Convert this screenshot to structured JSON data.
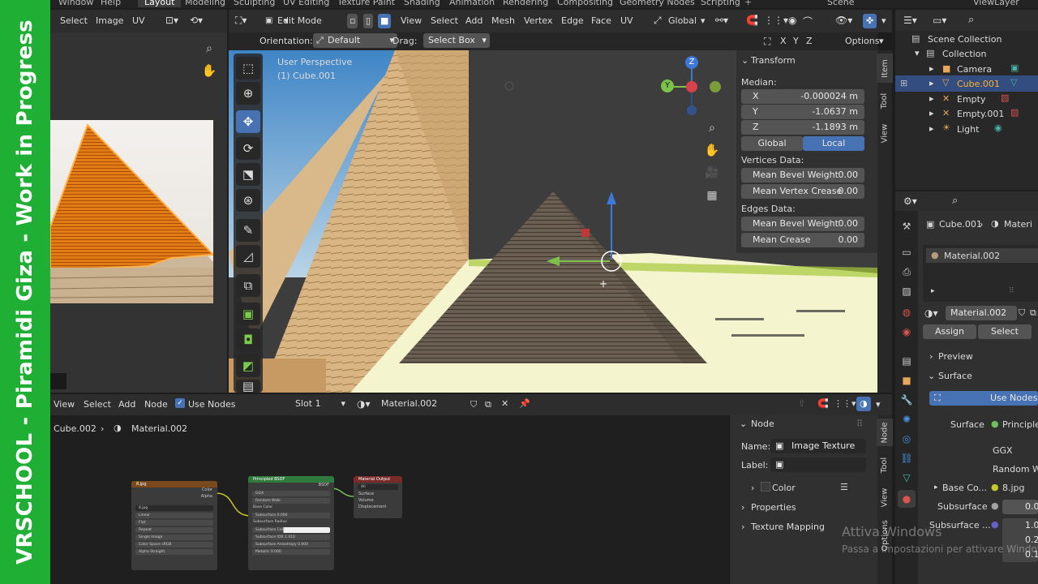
{
  "banner": {
    "text": "VRSCHOOL - Piramidi Giza - Work in Progress"
  },
  "menu": {
    "window": "Window",
    "help": "Help"
  },
  "workspaces": [
    "Layout",
    "Modeling",
    "Sculpting",
    "UV Editing",
    "Texture Paint",
    "Shading",
    "Animation",
    "Rendering",
    "Compositing",
    "Geometry Nodes",
    "Scripting"
  ],
  "scene": "Scene",
  "view_layer": "ViewLayer",
  "image_editor": {
    "select": "Select",
    "image": "Image",
    "uv": "UV"
  },
  "viewport_header": {
    "mode": "Edit Mode",
    "view": "View",
    "select": "Select",
    "add": "Add",
    "mesh": "Mesh",
    "vertex": "Vertex",
    "edge": "Edge",
    "face": "Face",
    "uv": "UV",
    "transform_orientation": "Global",
    "orientation_label": "Orientation:",
    "orientation_value": "Default",
    "drag_label": "Drag:",
    "drag_value": "Select Box",
    "axes": [
      "X",
      "Y",
      "Z"
    ],
    "options": "Options"
  },
  "viewport": {
    "perspective": "User Perspective",
    "object": "(1) Cube.001"
  },
  "gizmo": {
    "x": "X",
    "y": "Y",
    "z": "Z"
  },
  "npanel": {
    "title": "Transform",
    "median": "Median:",
    "fields": [
      {
        "label": "X",
        "value": "-0.000024 m"
      },
      {
        "label": "Y",
        "value": "-1.0637 m"
      },
      {
        "label": "Z",
        "value": "-1.1893 m"
      }
    ],
    "global": "Global",
    "local": "Local",
    "vertices_data": "Vertices Data:",
    "vertex_fields": [
      {
        "label": "Mean Bevel Weight",
        "value": "0.00"
      },
      {
        "label": "Mean Vertex Crease",
        "value": "0.00"
      }
    ],
    "edges_data": "Edges Data:",
    "edge_fields": [
      {
        "label": "Mean Bevel Weight",
        "value": "0.00"
      },
      {
        "label": "Mean Crease",
        "value": "0.00"
      }
    ],
    "tabs": [
      "Item",
      "Tool",
      "View"
    ]
  },
  "outliner": {
    "items": [
      {
        "label": "Scene Collection",
        "icon": "collection-icon"
      },
      {
        "label": "Collection",
        "icon": "collection-icon"
      },
      {
        "label": "Camera",
        "icon": "camera-icon"
      },
      {
        "label": "Cube.001",
        "icon": "mesh-icon",
        "selected": true
      },
      {
        "label": "Empty",
        "icon": "empty-icon"
      },
      {
        "label": "Empty.001",
        "icon": "empty-icon"
      },
      {
        "label": "Light",
        "icon": "light-icon"
      }
    ]
  },
  "properties": {
    "breadcrumb_object": "Cube.001",
    "breadcrumb_material": "Materi",
    "slot": "Material.002",
    "material": "Material.002",
    "assign": "Assign",
    "select": "Select",
    "preview": "Preview",
    "surface_section": "Surface",
    "use_nodes": "Use Nodes",
    "surface_label": "Surface",
    "surface_value": "Principled",
    "distribution": "GGX",
    "subsurface_method": "Random Wa",
    "base_color_label": "Base Co...",
    "base_color_value": "8.jpg",
    "subsurface_label": "Subsurface",
    "subsurface_value": "0.00",
    "subsurface2_label": "Subsurface ...",
    "subsurface2_values": [
      "1.0",
      "0.2",
      "0.1"
    ]
  },
  "node_editor": {
    "view": "View",
    "select": "Select",
    "add": "Add",
    "node": "Node",
    "use_nodes": "Use Nodes",
    "slot": "Slot 1",
    "material": "Material.002",
    "breadcrumb_object": "Cube.002",
    "breadcrumb_material": "Material.002"
  },
  "node_sidebar": {
    "title": "Node",
    "name_label": "Name:",
    "name_value": "Image Texture",
    "label_label": "Label:",
    "color": "Color",
    "properties": "Properties",
    "texture_mapping": "Texture Mapping",
    "tabs": [
      "Node",
      "Tool",
      "View",
      "Options"
    ]
  },
  "nodes": {
    "image": {
      "title": "8.jpg",
      "outputs": [
        "Color",
        "Alpha"
      ],
      "file": "8.jpg",
      "rows": [
        "Linear",
        "Flat",
        "Repeat",
        "Single Image",
        "Color Space   sRGB",
        "Alpha   Straight"
      ]
    },
    "bsdf": {
      "title": "Principled BSDF",
      "output": "BSDF",
      "rows": [
        "GGX",
        "Random Walk",
        "Base Color",
        "Subsurface   0.000",
        "Subsurface Radius",
        "Subsurface Colo",
        "Subsurface IOR   1.010",
        "Subsurface Anisotropy   0.000",
        "Metallic   0.000"
      ]
    },
    "output": {
      "title": "Material Output",
      "target": "All",
      "inputs": [
        "Surface",
        "Volume",
        "Displacement"
      ]
    }
  },
  "watermark": {
    "line1": "Attiva Windows",
    "line2": "Passa a Impostazioni per attivare Windows."
  },
  "colors": {
    "accent": "#4772b3",
    "banner": "#1faf35",
    "header": "#2d2d2d",
    "panel": "#303030"
  }
}
